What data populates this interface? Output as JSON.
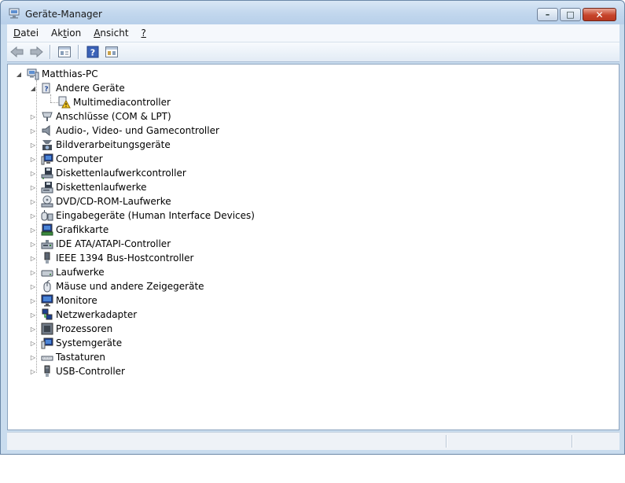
{
  "window": {
    "title": "Geräte-Manager",
    "controls": {
      "minimize": "–",
      "maximize": "□",
      "close": "✕"
    }
  },
  "menu": [
    {
      "access_key": "D",
      "rest": "atei"
    },
    {
      "pre": "Ak",
      "access_key": "t",
      "rest": "ion"
    },
    {
      "access_key": "A",
      "rest": "nsicht"
    },
    {
      "access_key": "?",
      "rest": ""
    }
  ],
  "toolbar": {
    "buttons": [
      "back-icon",
      "forward-icon",
      "properties-view-icon",
      "help-icon",
      "show-hidden-icon"
    ]
  },
  "tree": {
    "root": {
      "label": "Matthias-PC",
      "expanded": true
    },
    "items": [
      {
        "label": "Andere Geräte",
        "icon": "unknown-device-icon",
        "expanded": true,
        "children": [
          {
            "label": "Multimediacontroller",
            "icon": "warning-device-icon"
          }
        ]
      },
      {
        "label": "Anschlüsse (COM & LPT)",
        "icon": "port-icon"
      },
      {
        "label": "Audio-, Video- und Gamecontroller",
        "icon": "speaker-icon"
      },
      {
        "label": "Bildverarbeitungsgeräte",
        "icon": "camera-icon"
      },
      {
        "label": "Computer",
        "icon": "computer-icon"
      },
      {
        "label": "Diskettenlaufwerkcontroller",
        "icon": "floppy-controller-icon"
      },
      {
        "label": "Diskettenlaufwerke",
        "icon": "floppy-drive-icon"
      },
      {
        "label": "DVD/CD-ROM-Laufwerke",
        "icon": "dvd-icon"
      },
      {
        "label": "Eingabegeräte (Human Interface Devices)",
        "icon": "hid-icon"
      },
      {
        "label": "Grafikkarte",
        "icon": "display-adapter-icon"
      },
      {
        "label": "IDE ATA/ATAPI-Controller",
        "icon": "ide-icon"
      },
      {
        "label": "IEEE 1394 Bus-Hostcontroller",
        "icon": "firewire-icon"
      },
      {
        "label": "Laufwerke",
        "icon": "disk-drive-icon"
      },
      {
        "label": "Mäuse und andere Zeigegeräte",
        "icon": "mouse-icon"
      },
      {
        "label": "Monitore",
        "icon": "monitor-icon"
      },
      {
        "label": "Netzwerkadapter",
        "icon": "network-icon"
      },
      {
        "label": "Prozessoren",
        "icon": "cpu-icon"
      },
      {
        "label": "Systemgeräte",
        "icon": "system-icon"
      },
      {
        "label": "Tastaturen",
        "icon": "keyboard-icon"
      },
      {
        "label": "USB-Controller",
        "icon": "usb-icon"
      }
    ]
  },
  "colors": {
    "title_bar": "#c3d8ee",
    "close_button": "#c7442b",
    "tree_background": "#ffffff"
  }
}
